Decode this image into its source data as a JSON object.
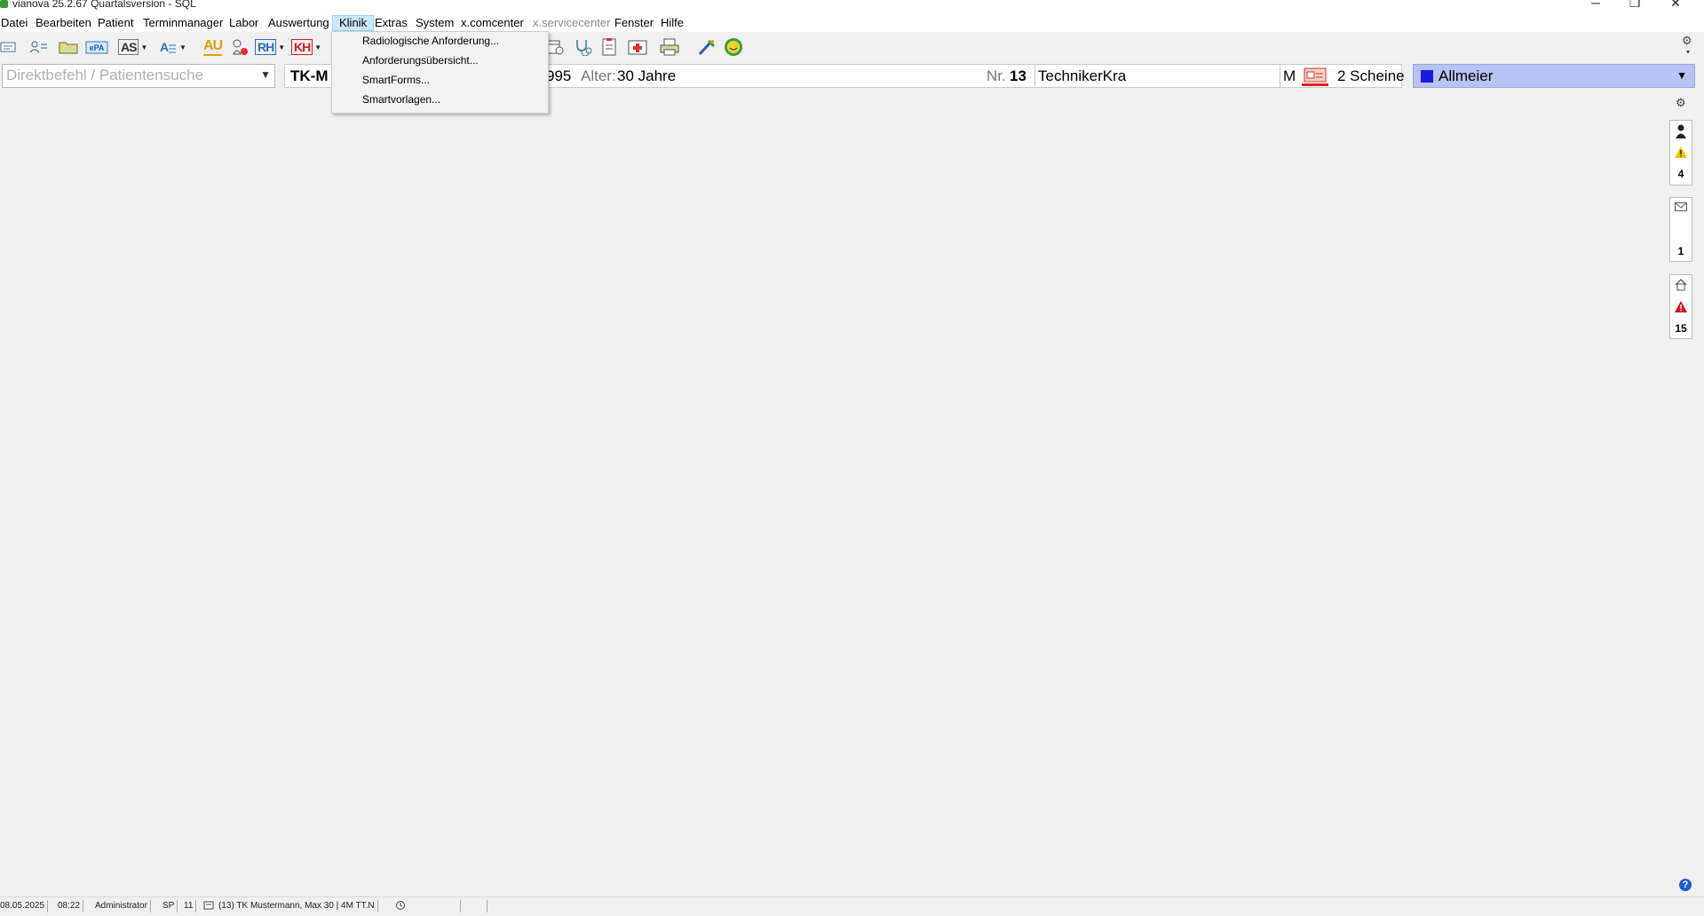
{
  "window": {
    "title": "vianova 25.2.67 Quartalsversion - SQL",
    "minimize_glyph": "─",
    "maximize_glyph": "❐",
    "close_glyph": "✕"
  },
  "menu": {
    "items": [
      "Datei",
      "Bearbeiten",
      "Patient",
      "Terminmanager",
      "Labor",
      "Auswertung",
      "Klinik",
      "Extras",
      "System",
      "x.comcenter",
      "x.servicecenter",
      "Fenster",
      "Hilfe"
    ],
    "active": "Klinik"
  },
  "toolbar": {
    "au_label": "AU",
    "as_label": "AS",
    "rh_label": "RH",
    "kh_label": "KH",
    "epa_label": "ePA"
  },
  "klinik_menu": {
    "options": [
      "Radiologische Anforderung...",
      "Anforderungsübersicht...",
      "SmartForms...",
      "Smartvorlagen..."
    ]
  },
  "search": {
    "placeholder": "Direktbefehl / Patientensuche",
    "value": ""
  },
  "patient": {
    "insurer_short": "TK-M",
    "birth_year_fragment": "995",
    "age_label": "Alter:",
    "age_value": "30 Jahre",
    "nr_label": "Nr.",
    "nr_value": "13",
    "insurance": "TechnikerKra",
    "gender": "M",
    "scheine": "2 Scheine"
  },
  "doctor": {
    "name": "Allmeier",
    "color": "#1a1ae0"
  },
  "side_panel": {
    "alerts_count": "4",
    "messages_count": "1",
    "warnings_count": "15"
  },
  "status": {
    "date": "08.05.2025",
    "time": "08:22",
    "user": "Administrator",
    "code": "SP",
    "number": "11",
    "patient_info": "(13) TK Mustermann, Max 30 | 4M TT.N"
  },
  "colors": {
    "menu_active_bg": "#cce8ff",
    "doctor_bg": "#b9c3f3",
    "warning_red": "#d01818",
    "help_blue": "#1a5fd0"
  }
}
